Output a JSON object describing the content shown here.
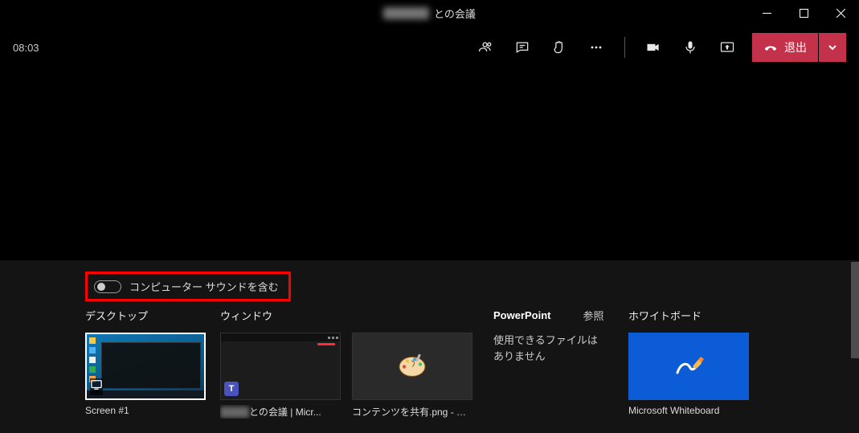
{
  "window": {
    "title_suffix": "との会議"
  },
  "toolbar": {
    "timer": "08:03",
    "leave_label": "退出"
  },
  "share": {
    "sound_toggle_label": "コンピューター サウンドを含む",
    "desktop_heading": "デスクトップ",
    "window_heading": "ウィンドウ",
    "powerpoint_heading": "PowerPoint",
    "browse_label": "参照",
    "no_files_message": "使用できるファイルはありません",
    "whiteboard_heading": "ホワイトボード",
    "desktop_items": [
      {
        "label": "Screen #1"
      }
    ],
    "window_items": [
      {
        "label_suffix": "との会議 | Micr..."
      },
      {
        "label": "コンテンツを共有.png - ペイ..."
      }
    ],
    "whiteboard_items": [
      {
        "label": "Microsoft Whiteboard"
      }
    ]
  }
}
